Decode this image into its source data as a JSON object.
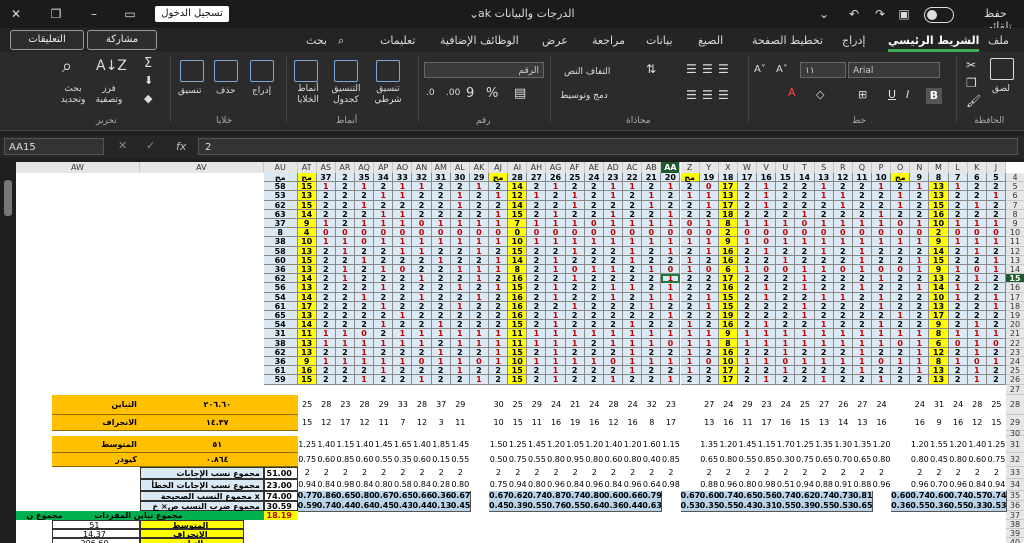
{
  "titlebar": {
    "autosave_label": "حفظ تلقائي",
    "file_title": "ak الدرجات والبيانات",
    "signin_label": "تسجيل الدخول"
  },
  "tabs": [
    "ملف",
    "الشريط الرئيسي",
    "إدراج",
    "تخطيط الصفحة",
    "الصيغ",
    "بيانات",
    "مراجعة",
    "عرض",
    "الوظائف الإضافية",
    "تعليمات",
    "بحث"
  ],
  "active_tab": "الشريط الرئيسي",
  "buttons": {
    "comments": "التعليقات",
    "share": "مشاركة"
  },
  "ribbon": {
    "clipboard": {
      "group": "الحافظة",
      "paste": "لصق"
    },
    "font": {
      "group": "خط",
      "font_name": "Arial",
      "font_size": "١١"
    },
    "alignment": {
      "group": "محاذاة",
      "wrap": "التفاف النص",
      "merge": "دمج وتوسيط"
    },
    "number": {
      "group": "رقم",
      "format": "الرقم"
    },
    "styles": {
      "group": "أنماط",
      "conditional": "تنسيق شرطي",
      "as_table": "التنسيق كجدول",
      "cell_styles": "أنماط الخلايا"
    },
    "cells": {
      "group": "خلايا",
      "insert": "إدراج",
      "delete": "حذف",
      "format": "تنسيق"
    },
    "editing": {
      "group": "تحرير",
      "sort": "فرز وتصفية",
      "find": "بحث وتحديد"
    }
  },
  "formula_bar": {
    "name_box": "AA15",
    "value": "2"
  },
  "colors": {
    "accent": "#3fae5b",
    "header_selected": "#1e5c30",
    "data_fill": "#dbe9f5",
    "yellow": "#ffff00",
    "orange": "#ffc000",
    "green": "#00b050"
  },
  "columns": [
    "AW",
    "AV",
    "AU",
    "AT",
    "AS",
    "AR",
    "AQ",
    "AP",
    "AO",
    "AN",
    "AM",
    "AL",
    "AK",
    "AJ",
    "AI",
    "AH",
    "AG",
    "AF",
    "AE",
    "AD",
    "AC",
    "AB",
    "AA",
    "Z",
    "Y",
    "X",
    "W",
    "V",
    "U",
    "T",
    "S",
    "R",
    "Q",
    "P",
    "O",
    "N",
    "M",
    "L",
    "K",
    "J"
  ],
  "selected_column": "AA",
  "rows": [
    "4",
    "5",
    "6",
    "7",
    "8",
    "9",
    "10",
    "11",
    "12",
    "13",
    "14",
    "15",
    "16",
    "17",
    "18",
    "19",
    "20",
    "21",
    "22",
    "23",
    "24",
    "25",
    "26",
    "27",
    "28",
    "29",
    "30",
    "31",
    "32",
    "33",
    "34",
    "35",
    "36"
  ],
  "selected_row": "15",
  "header_row": [
    "مج",
    "37",
    "2",
    "35",
    "34",
    "33",
    "32",
    "31",
    "30",
    "29",
    "مج",
    "28",
    "27",
    "26",
    "25",
    "24",
    "23",
    "22",
    "21",
    "20",
    "مج",
    "19",
    "18",
    "17",
    "16",
    "15",
    "14",
    "13",
    "12",
    "11",
    "10",
    "مج",
    "9",
    "8",
    "7",
    "6",
    "5"
  ],
  "data_rows": [
    [
      "58",
      "15",
      "1",
      "2",
      "1",
      "2",
      "1",
      "1",
      "2",
      "2",
      "1",
      "2",
      "14",
      "2",
      "1",
      "2",
      "2",
      "1",
      "1",
      "2",
      "1",
      "2",
      "0",
      "17",
      "2",
      "1",
      "2",
      "2",
      "1",
      "2",
      "2",
      "1",
      "2",
      "1",
      "13",
      "1",
      "2",
      "2",
      "1",
      "1"
    ],
    [
      "53",
      "13",
      "2",
      "2",
      "2",
      "1",
      "1",
      "2",
      "2",
      "1",
      "2",
      "1",
      "12",
      "1",
      "2",
      "1",
      "2",
      "1",
      "2",
      "1",
      "2",
      "1",
      "1",
      "13",
      "2",
      "1",
      "2",
      "2",
      "1",
      "1",
      "2",
      "2",
      "1",
      "2",
      "13",
      "2",
      "2",
      "1",
      "2",
      "1"
    ],
    [
      "62",
      "15",
      "2",
      "2",
      "1",
      "2",
      "2",
      "2",
      "2",
      "1",
      "2",
      "2",
      "14",
      "2",
      "2",
      "1",
      "2",
      "2",
      "2",
      "1",
      "2",
      "2",
      "1",
      "17",
      "2",
      "1",
      "2",
      "2",
      "2",
      "1",
      "2",
      "2",
      "1",
      "2",
      "15",
      "2",
      "1",
      "2",
      "2",
      "2"
    ],
    [
      "63",
      "14",
      "2",
      "2",
      "2",
      "1",
      "1",
      "2",
      "2",
      "2",
      "2",
      "1",
      "15",
      "2",
      "1",
      "2",
      "2",
      "1",
      "2",
      "2",
      "1",
      "2",
      "2",
      "18",
      "2",
      "2",
      "2",
      "1",
      "2",
      "2",
      "2",
      "1",
      "2",
      "2",
      "16",
      "2",
      "2",
      "2",
      "1",
      "2"
    ],
    [
      "37",
      "9",
      "1",
      "2",
      "1",
      "1",
      "1",
      "0",
      "1",
      "1",
      "1",
      "1",
      "7",
      "1",
      "1",
      "1",
      "0",
      "1",
      "1",
      "1",
      "1",
      "0",
      "1",
      "8",
      "1",
      "1",
      "1",
      "0",
      "1",
      "1",
      "1",
      "1",
      "0",
      "1",
      "10",
      "1",
      "1",
      "1",
      "0",
      "1"
    ],
    [
      "8",
      "4",
      "0",
      "0",
      "0",
      "0",
      "0",
      "0",
      "0",
      "0",
      "0",
      "0",
      "0",
      "0",
      "0",
      "0",
      "0",
      "0",
      "0",
      "0",
      "0",
      "0",
      "0",
      "2",
      "0",
      "0",
      "0",
      "0",
      "0",
      "0",
      "0",
      "0",
      "0",
      "0",
      "2",
      "0",
      "0",
      "0",
      "0",
      "2"
    ],
    [
      "38",
      "10",
      "1",
      "1",
      "0",
      "1",
      "1",
      "1",
      "1",
      "1",
      "1",
      "1",
      "10",
      "1",
      "1",
      "1",
      "1",
      "1",
      "1",
      "1",
      "1",
      "1",
      "1",
      "9",
      "1",
      "0",
      "1",
      "1",
      "1",
      "1",
      "1",
      "1",
      "1",
      "1",
      "9",
      "1",
      "1",
      "1",
      "1",
      "1"
    ],
    [
      "58",
      "13",
      "2",
      "1",
      "2",
      "2",
      "1",
      "1",
      "2",
      "2",
      "1",
      "2",
      "15",
      "2",
      "2",
      "1",
      "2",
      "2",
      "1",
      "2",
      "1",
      "2",
      "1",
      "16",
      "2",
      "1",
      "2",
      "2",
      "1",
      "2",
      "1",
      "2",
      "2",
      "2",
      "14",
      "2",
      "1",
      "2",
      "2",
      "1"
    ],
    [
      "60",
      "15",
      "2",
      "2",
      "1",
      "2",
      "2",
      "2",
      "1",
      "2",
      "2",
      "1",
      "14",
      "2",
      "1",
      "2",
      "2",
      "2",
      "1",
      "2",
      "2",
      "1",
      "2",
      "16",
      "2",
      "2",
      "1",
      "2",
      "2",
      "2",
      "1",
      "2",
      "2",
      "1",
      "15",
      "2",
      "2",
      "1",
      "2",
      "2"
    ],
    [
      "36",
      "13",
      "2",
      "1",
      "2",
      "1",
      "0",
      "2",
      "2",
      "1",
      "1",
      "1",
      "8",
      "2",
      "1",
      "0",
      "1",
      "1",
      "2",
      "1",
      "0",
      "1",
      "0",
      "6",
      "1",
      "0",
      "0",
      "1",
      "1",
      "0",
      "1",
      "0",
      "0",
      "1",
      "9",
      "1",
      "0",
      "1",
      "0",
      "1"
    ],
    [
      "62",
      "14",
      "2",
      "1",
      "2",
      "2",
      "2",
      "1",
      "2",
      "2",
      "1",
      "2",
      "16",
      "2",
      "2",
      "1",
      "2",
      "2",
      "2",
      "2",
      "1",
      "2",
      "2",
      "17",
      "2",
      "2",
      "2",
      "1",
      "2",
      "2",
      "2",
      "1",
      "2",
      "2",
      "13",
      "2",
      "1",
      "2",
      "1",
      "2"
    ],
    [
      "56",
      "13",
      "2",
      "2",
      "2",
      "1",
      "2",
      "2",
      "2",
      "1",
      "2",
      "1",
      "15",
      "2",
      "1",
      "2",
      "2",
      "1",
      "1",
      "2",
      "1",
      "2",
      "2",
      "16",
      "2",
      "1",
      "2",
      "1",
      "2",
      "2",
      "1",
      "2",
      "2",
      "1",
      "14",
      "1",
      "2",
      "2",
      "2",
      "1"
    ],
    [
      "54",
      "14",
      "2",
      "2",
      "1",
      "2",
      "2",
      "1",
      "2",
      "2",
      "1",
      "2",
      "16",
      "2",
      "1",
      "2",
      "2",
      "1",
      "2",
      "1",
      "1",
      "2",
      "1",
      "15",
      "2",
      "1",
      "2",
      "2",
      "1",
      "1",
      "2",
      "1",
      "2",
      "2",
      "10",
      "1",
      "2",
      "1",
      "1",
      "2"
    ],
    [
      "61",
      "17",
      "2",
      "2",
      "2",
      "1",
      "2",
      "2",
      "2",
      "1",
      "2",
      "2",
      "16",
      "2",
      "2",
      "1",
      "2",
      "2",
      "2",
      "1",
      "2",
      "2",
      "1",
      "15",
      "2",
      "2",
      "2",
      "1",
      "2",
      "2",
      "2",
      "1",
      "2",
      "2",
      "13",
      "2",
      "2",
      "1",
      "2",
      "2"
    ],
    [
      "65",
      "13",
      "2",
      "2",
      "2",
      "2",
      "1",
      "2",
      "2",
      "2",
      "2",
      "2",
      "16",
      "2",
      "1",
      "2",
      "2",
      "2",
      "2",
      "2",
      "1",
      "2",
      "2",
      "19",
      "2",
      "2",
      "2",
      "1",
      "2",
      "2",
      "2",
      "2",
      "1",
      "2",
      "17",
      "2",
      "2",
      "2",
      "1",
      "2"
    ],
    [
      "54",
      "14",
      "2",
      "2",
      "2",
      "1",
      "2",
      "2",
      "1",
      "2",
      "2",
      "2",
      "15",
      "2",
      "1",
      "2",
      "2",
      "2",
      "1",
      "2",
      "2",
      "1",
      "2",
      "16",
      "2",
      "1",
      "2",
      "2",
      "1",
      "2",
      "2",
      "1",
      "2",
      "2",
      "9",
      "2",
      "1",
      "2",
      "1",
      "1"
    ],
    [
      "31",
      "11",
      "1",
      "1",
      "0",
      "2",
      "1",
      "1",
      "1",
      "1",
      "1",
      "1",
      "11",
      "1",
      "1",
      "1",
      "1",
      "1",
      "1",
      "1",
      "1",
      "1",
      "1",
      "9",
      "1",
      "1",
      "1",
      "1",
      "1",
      "1",
      "1",
      "1",
      "1",
      "1",
      "8",
      "1",
      "1",
      "1",
      "0",
      "1"
    ],
    [
      "38",
      "13",
      "1",
      "1",
      "1",
      "1",
      "1",
      "1",
      "2",
      "1",
      "1",
      "1",
      "11",
      "1",
      "1",
      "1",
      "2",
      "1",
      "1",
      "1",
      "0",
      "1",
      "1",
      "8",
      "1",
      "1",
      "1",
      "1",
      "1",
      "1",
      "1",
      "1",
      "0",
      "1",
      "6",
      "0",
      "1",
      "0",
      "1",
      "2"
    ],
    [
      "62",
      "13",
      "2",
      "2",
      "1",
      "2",
      "2",
      "2",
      "1",
      "2",
      "2",
      "1",
      "15",
      "2",
      "1",
      "2",
      "2",
      "2",
      "1",
      "2",
      "2",
      "1",
      "2",
      "16",
      "2",
      "2",
      "1",
      "2",
      "2",
      "2",
      "1",
      "2",
      "2",
      "1",
      "12",
      "2",
      "1",
      "2",
      "2",
      "1"
    ],
    [
      "36",
      "9",
      "1",
      "1",
      "1",
      "1",
      "1",
      "0",
      "1",
      "1",
      "0",
      "1",
      "10",
      "1",
      "1",
      "1",
      "1",
      "0",
      "1",
      "1",
      "1",
      "1",
      "0",
      "10",
      "1",
      "1",
      "0",
      "1",
      "1",
      "1",
      "1",
      "0",
      "1",
      "1",
      "8",
      "1",
      "0",
      "1",
      "1",
      "1"
    ],
    [
      "61",
      "16",
      "2",
      "2",
      "2",
      "1",
      "2",
      "2",
      "2",
      "1",
      "2",
      "2",
      "15",
      "2",
      "1",
      "2",
      "2",
      "2",
      "1",
      "2",
      "2",
      "1",
      "2",
      "17",
      "2",
      "2",
      "1",
      "2",
      "2",
      "2",
      "1",
      "2",
      "2",
      "1",
      "13",
      "2",
      "1",
      "2",
      "1",
      "2"
    ],
    [
      "59",
      "15",
      "2",
      "2",
      "1",
      "2",
      "2",
      "1",
      "2",
      "2",
      "1",
      "2",
      "15",
      "2",
      "1",
      "2",
      "2",
      "1",
      "2",
      "2",
      "1",
      "2",
      "2",
      "17",
      "2",
      "1",
      "2",
      "2",
      "1",
      "2",
      "2",
      "1",
      "2",
      "2",
      "13",
      "2",
      "1",
      "2",
      "1",
      "2"
    ]
  ],
  "stats_left": {
    "labels": [
      "التباين",
      "الانحراف",
      "المتوسط",
      "كيودر"
    ],
    "values": [
      "٢٠٦.٦٠",
      "١٤.٣٧",
      "٥١",
      "٠.٨٦٤"
    ]
  },
  "sum_rows": {
    "labels": [
      "مجموع نسب الإجابات الصحيحة",
      "مجموع نسب الإجابات الخطأ",
      "مجموع النسب الصحيحة x الخطأ",
      "مجموع ضرب النسب ص× خ"
    ],
    "values": [
      "51.00",
      "23.00",
      "74.00",
      "30.59"
    ],
    "row26": [
      "25",
      "28",
      "23",
      "28",
      "29",
      "33",
      "28",
      "37",
      "29",
      "",
      "30",
      "25",
      "29",
      "24",
      "21",
      "24",
      "28",
      "24",
      "32",
      "23",
      "",
      "27",
      "24",
      "29",
      "23",
      "24",
      "25",
      "27",
      "26",
      "27",
      "24",
      "",
      "24",
      "31",
      "24",
      "28",
      "25"
    ],
    "row27": [
      "15",
      "12",
      "17",
      "12",
      "11",
      "7",
      "12",
      "3",
      "11",
      "",
      "10",
      "15",
      "11",
      "16",
      "19",
      "16",
      "12",
      "16",
      "8",
      "17",
      "",
      "13",
      "16",
      "11",
      "17",
      "16",
      "15",
      "13",
      "14",
      "13",
      "16",
      "",
      "16",
      "9",
      "16",
      "12",
      "15"
    ],
    "row28": [
      "1.25",
      "1.40",
      "1.15",
      "1.40",
      "1.45",
      "1.65",
      "1.40",
      "1.85",
      "1.45",
      "",
      "1.50",
      "1.25",
      "1.45",
      "1.20",
      "1.05",
      "1.20",
      "1.40",
      "1.20",
      "1.60",
      "1.15",
      "",
      "1.35",
      "1.20",
      "1.45",
      "1.15",
      "1.70",
      "1.25",
      "1.35",
      "1.30",
      "1.35",
      "1.20",
      "",
      "1.20",
      "1.55",
      "1.20",
      "1.40",
      "1.25"
    ],
    "row29": [
      "0.75",
      "0.60",
      "0.85",
      "0.60",
      "0.55",
      "0.35",
      "0.60",
      "0.15",
      "0.55",
      "",
      "0.50",
      "0.75",
      "0.55",
      "0.80",
      "0.95",
      "0.80",
      "0.60",
      "0.80",
      "0.40",
      "0.85",
      "",
      "0.65",
      "0.80",
      "0.55",
      "0.85",
      "0.30",
      "0.75",
      "0.65",
      "0.70",
      "0.65",
      "0.80",
      "",
      "0.80",
      "0.45",
      "0.80",
      "0.60",
      "0.75"
    ],
    "row31": [
      "2",
      "2",
      "2",
      "2",
      "2",
      "2",
      "2",
      "2",
      "2",
      "",
      "2",
      "2",
      "2",
      "2",
      "2",
      "2",
      "2",
      "2",
      "2",
      "2",
      "",
      "2",
      "2",
      "2",
      "2",
      "2",
      "2",
      "2",
      "2",
      "2",
      "2",
      "",
      "2",
      "2",
      "2",
      "2",
      "2"
    ],
    "row32": [
      "0.94",
      "0.84",
      "0.98",
      "0.84",
      "0.80",
      "0.58",
      "0.84",
      "0.28",
      "0.80",
      "",
      "0.75",
      "0.94",
      "0.80",
      "0.96",
      "0.84",
      "0.96",
      "0.84",
      "0.96",
      "0.64",
      "0.98",
      "",
      "0.88",
      "0.96",
      "0.80",
      "0.98",
      "0.51",
      "0.94",
      "0.88",
      "0.91",
      "0.88",
      "0.96",
      "",
      "0.96",
      "0.70",
      "0.96",
      "0.84",
      "0.94"
    ],
    "row33": [
      "0.77",
      "0.86",
      "0.65",
      "0.80",
      "0.67",
      "0.65",
      "0.66",
      "0.36",
      "0.67",
      "",
      "0.67",
      "0.62",
      "0.74",
      "0.87",
      "0.74",
      "0.80",
      "0.60",
      "0.66",
      "0.79",
      "",
      "0.67",
      "0.60",
      "0.74",
      "0.65",
      "0.56",
      "0.74",
      "0.62",
      "0.74",
      "0.73",
      "0.81",
      "",
      "0.60",
      "0.74",
      "0.60",
      "0.74",
      "0.57",
      "0.74"
    ],
    "row34": [
      "0.59",
      "0.74",
      "0.44",
      "0.64",
      "0.45",
      "0.43",
      "0.44",
      "0.13",
      "0.45",
      "",
      "0.45",
      "0.39",
      "0.55",
      "0.76",
      "0.55",
      "0.64",
      "0.36",
      "0.44",
      "0.63",
      "",
      "0.53",
      "0.35",
      "0.55",
      "0.43",
      "0.31",
      "0.55",
      "0.39",
      "0.55",
      "0.53",
      "0.65",
      "",
      "0.36",
      "0.55",
      "0.36",
      "0.55",
      "0.33",
      "0.53"
    ],
    "total_label": "مجموع تباين المفردات",
    "total_value": "18.19",
    "sum_label": "مجموع ن"
  },
  "bottom_table": {
    "labels": [
      "المتوسط",
      "الانحراف",
      "التباين"
    ],
    "values": [
      "51",
      "14.37",
      "206.60"
    ]
  }
}
